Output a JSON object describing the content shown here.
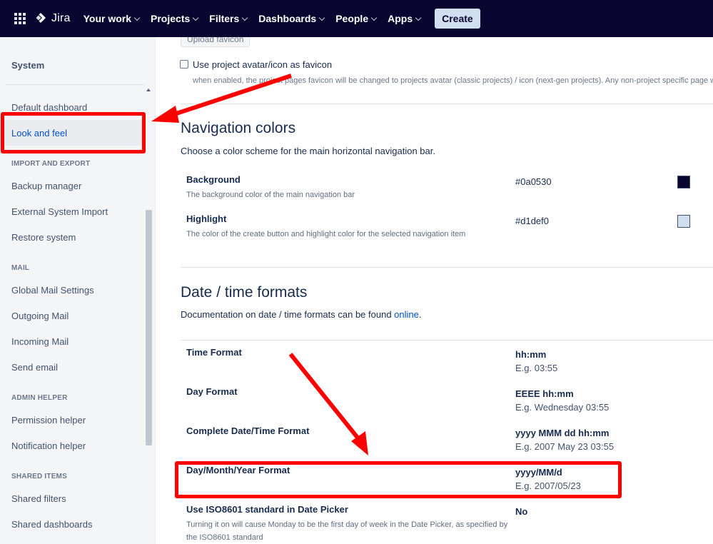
{
  "topnav": {
    "logo": "Jira",
    "items": [
      {
        "label": "Your work"
      },
      {
        "label": "Projects"
      },
      {
        "label": "Filters"
      },
      {
        "label": "Dashboards"
      },
      {
        "label": "People"
      },
      {
        "label": "Apps"
      }
    ],
    "create_label": "Create",
    "background": "#0a0530",
    "highlight": "#d1def0"
  },
  "sidebar": {
    "title": "System",
    "items": [
      {
        "label": "Default dashboard"
      },
      {
        "label": "Look and feel"
      },
      {
        "label": "Backup manager"
      },
      {
        "label": "External System Import"
      },
      {
        "label": "Restore system"
      },
      {
        "label": "Global Mail Settings"
      },
      {
        "label": "Outgoing Mail"
      },
      {
        "label": "Incoming Mail"
      },
      {
        "label": "Send email"
      },
      {
        "label": "Permission helper"
      },
      {
        "label": "Notification helper"
      },
      {
        "label": "Shared filters"
      },
      {
        "label": "Shared dashboards"
      }
    ],
    "headings": [
      "IMPORT AND EXPORT",
      "MAIL",
      "ADMIN HELPER",
      "SHARED ITEMS"
    ]
  },
  "main": {
    "upload_favicon_label": "Upload favicon",
    "favicon_checkbox_label": "Use project avatar/icon as favicon",
    "favicon_description": "when enabled, the project pages favicon will be changed to projects avatar (classic projects) / icon (next-gen projects). Any non-project specific page w",
    "navigation_colors": {
      "title": "Navigation colors",
      "description": "Choose a color scheme for the main horizontal navigation bar.",
      "rows": [
        {
          "label": "Background",
          "description": "The background color of the main navigation bar",
          "value": "#0a0530",
          "swatch": "#0a0530"
        },
        {
          "label": "Highlight",
          "description": "The color of the create button and highlight color for the selected navigation item",
          "value": "#d1def0",
          "swatch": "#d1def0"
        }
      ]
    },
    "date_time": {
      "title": "Date / time formats",
      "description_prefix": "Documentation on date / time formats can be found ",
      "link_text": "online",
      "description_suffix": ".",
      "rows": [
        {
          "label": "Time Format",
          "value": "hh:mm",
          "example": "E.g. 03:55"
        },
        {
          "label": "Day Format",
          "value": "EEEE hh:mm",
          "example": "E.g. Wednesday 03:55"
        },
        {
          "label": "Complete Date/Time Format",
          "value": "yyyy MMM dd hh:mm",
          "example": "E.g. 2007 May 23 03:55"
        },
        {
          "label": "Day/Month/Year Format",
          "value": "yyyy/MM/d",
          "example": "E.g. 2007/05/23"
        },
        {
          "label": "Use ISO8601 standard in Date Picker",
          "value": "No",
          "description": "Turning it on will cause Monday to be the first day of week in the Date Picker, as specified by the ISO8601 standard"
        }
      ]
    }
  },
  "annotation_color": "#ff0000"
}
